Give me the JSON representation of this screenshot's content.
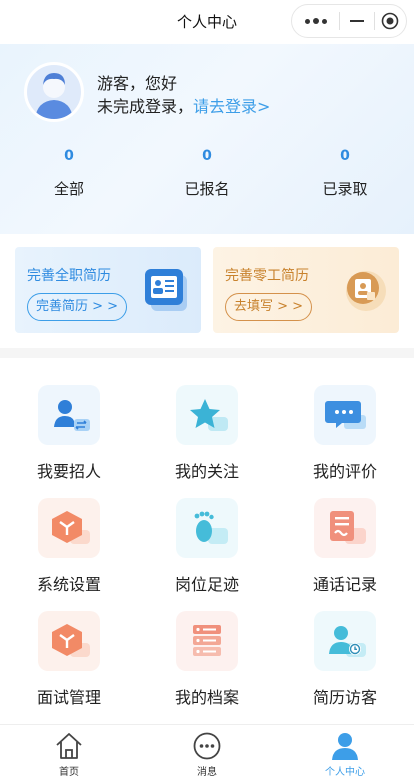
{
  "navbar": {
    "title": "个人中心"
  },
  "user": {
    "greeting": "游客，您好",
    "login_prompt": "未完成登录，",
    "login_link": "请去登录>"
  },
  "stats": [
    {
      "value": "0",
      "label": "全部"
    },
    {
      "value": "0",
      "label": "已报名"
    },
    {
      "value": "0",
      "label": "已录取"
    }
  ],
  "cards": {
    "full_time": {
      "title": "完善全职简历",
      "button": "完善简历 > >"
    },
    "part_time": {
      "title": "完善零工简历",
      "button": "去填写 > >"
    }
  },
  "menu": [
    {
      "label": "我要招人",
      "icon": "recruit-icon"
    },
    {
      "label": "我的关注",
      "icon": "star-icon"
    },
    {
      "label": "我的评价",
      "icon": "comment-icon"
    },
    {
      "label": "系统设置",
      "icon": "settings-box-icon"
    },
    {
      "label": "岗位足迹",
      "icon": "footprint-icon"
    },
    {
      "label": "通话记录",
      "icon": "call-log-icon"
    },
    {
      "label": "面试管理",
      "icon": "interview-box-icon"
    },
    {
      "label": "我的档案",
      "icon": "archive-icon"
    },
    {
      "label": "简历访客",
      "icon": "visitor-icon"
    }
  ],
  "tabbar": [
    {
      "label": "首页",
      "icon": "home-icon"
    },
    {
      "label": "消息",
      "icon": "message-icon"
    },
    {
      "label": "个人中心",
      "icon": "profile-icon",
      "active": true
    }
  ],
  "colors": {
    "accent": "#3d9ee8",
    "warm": "#c8822d"
  }
}
